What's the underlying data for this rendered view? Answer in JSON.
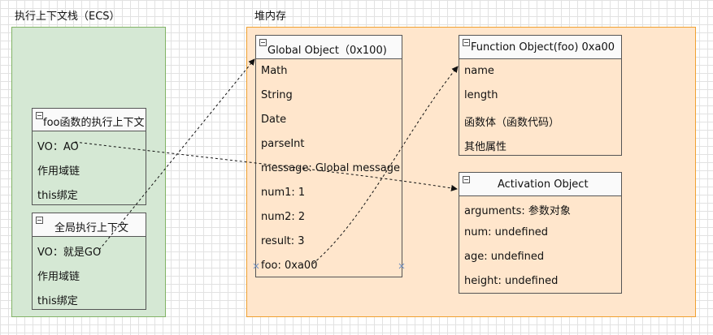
{
  "ecs": {
    "label": "执行上下文栈（ECS）",
    "foo_context": {
      "title": "foo函数的执行上下文",
      "rows": [
        "VO：AO",
        "作用域链",
        "this绑定"
      ]
    },
    "global_context": {
      "title": "全局执行上下文",
      "rows": [
        "VO：就是GO",
        "作用域链",
        "this绑定"
      ]
    }
  },
  "heap": {
    "label": "堆内存",
    "global_object": {
      "title": "Global Object（0x100)",
      "rows": [
        "Math",
        "String",
        "Date",
        "parseInt",
        "message: Global message",
        "num1: 1",
        "num2: 2",
        "result: 3",
        "foo: 0xa00"
      ]
    },
    "function_object": {
      "title": "Function Object(foo) 0xa00",
      "rows": [
        "name",
        "length",
        "函数体（函数代码）",
        "其他属性"
      ]
    },
    "activation_object": {
      "title": "Activation Object",
      "rows": [
        "arguments: 参数对象",
        "num: undefined",
        "age: undefined",
        "height: undefined"
      ]
    }
  },
  "colors": {
    "ecs_fill": "#d5e8d4",
    "ecs_border": "#82b366",
    "heap_fill": "#ffe6cc",
    "heap_border": "#f0a030",
    "grid": "#e2e2e2",
    "arrow": "#111111",
    "selection_marker": "#6c8ebf"
  }
}
